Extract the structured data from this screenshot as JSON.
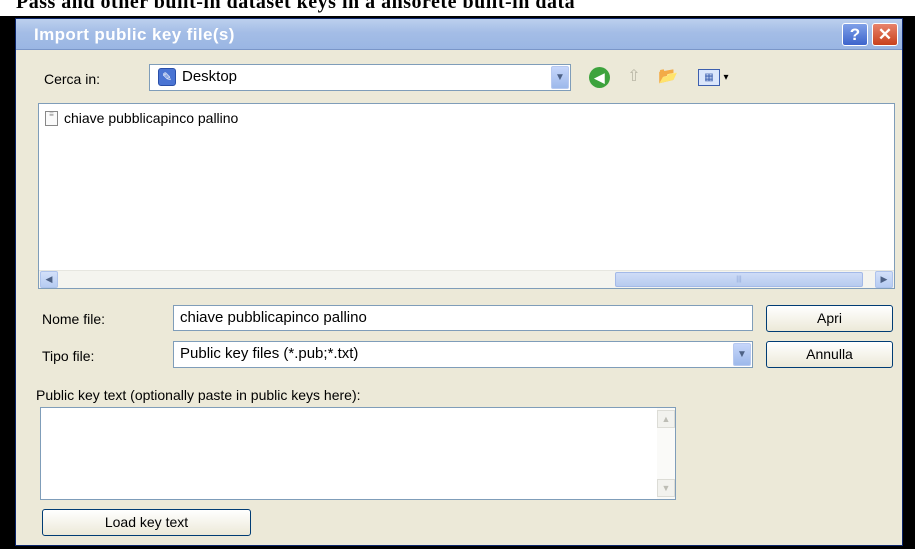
{
  "top_caption": "Pass and other built-in dataset keys in a ansorete built-in data",
  "window": {
    "title": "Import public key file(s)",
    "help_label": "?",
    "close_label": "✕"
  },
  "lookin": {
    "label": "Cerca in:",
    "value": "Desktop"
  },
  "toolbar": {
    "back_glyph": "◀",
    "up_glyph": "⇧",
    "new_folder_glyph": "📂",
    "view_glyph": "▦",
    "view_arrow": "▾"
  },
  "files": {
    "items": [
      {
        "name": "chiave pubblicapinco pallino",
        "icon": "text-file-icon"
      }
    ]
  },
  "scroll": {
    "left": "◀",
    "right": "▶",
    "thumb_grip": "|||"
  },
  "filename": {
    "label": "Nome file:",
    "value": "chiave pubblicapinco pallino"
  },
  "filetype": {
    "label": "Tipo file:",
    "value": "Public key files (*.pub;*.txt)"
  },
  "buttons": {
    "open": "Apri",
    "cancel": "Annulla",
    "load_key_text": "Load key text"
  },
  "public_key_text": {
    "label": "Public key text (optionally paste in public keys here):",
    "value": ""
  },
  "colors": {
    "titlebar": "#a4bde6",
    "window_bg": "#ece9d8",
    "border": "#7f9db9"
  }
}
